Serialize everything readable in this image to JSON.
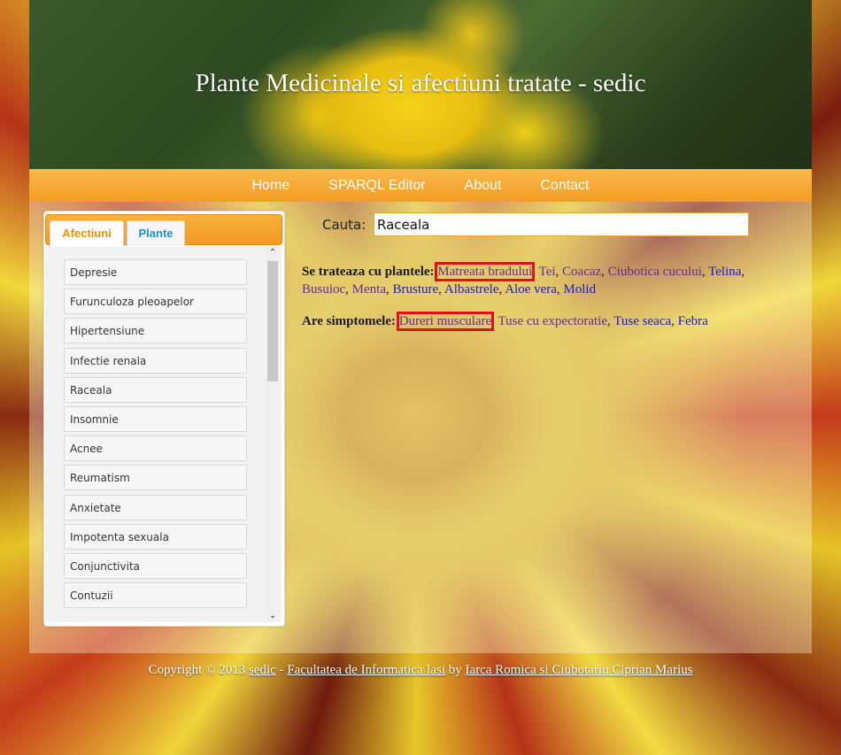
{
  "header": {
    "title": "Plante Medicinale si afectiuni tratate - sedic"
  },
  "nav": [
    "Home",
    "SPARQL Editor",
    "About",
    "Contact"
  ],
  "sidebar": {
    "tabs": [
      {
        "label": "Afectiuni",
        "active": true
      },
      {
        "label": "Plante",
        "active": false
      }
    ],
    "items": [
      "Depresie",
      "Furunculoza pleoapelor",
      "Hipertensiune",
      "Infectie renala",
      "Raceala",
      "Insomnie",
      "Acnee",
      "Reumatism",
      "Anxietate",
      "Impotenta sexuala",
      "Conjunctivita",
      "Contuzii"
    ]
  },
  "search": {
    "label": "Cauta:",
    "value": "Raceala"
  },
  "results": {
    "plants_label": "Se trateaza cu plantele:",
    "plants": [
      {
        "name": "Matreata bradului",
        "visited": true,
        "highlighted": true
      },
      {
        "name": "Tei",
        "visited": true
      },
      {
        "name": "Coacaz",
        "visited": true
      },
      {
        "name": "Ciubotica cucului",
        "visited": true
      },
      {
        "name": "Telina",
        "visited": false
      },
      {
        "name": "Busuioc",
        "visited": true
      },
      {
        "name": "Menta",
        "visited": true
      },
      {
        "name": "Brusture",
        "visited": false
      },
      {
        "name": "Albastrele",
        "visited": false
      },
      {
        "name": "Aloe vera",
        "visited": false
      },
      {
        "name": "Molid",
        "visited": false
      }
    ],
    "symptoms_label": "Are simptomele:",
    "symptoms": [
      {
        "name": "Dureri musculare",
        "visited": true,
        "highlighted": true
      },
      {
        "name": "Tuse cu expectoratie",
        "visited": true
      },
      {
        "name": "Tuse seaca",
        "visited": false
      },
      {
        "name": "Febra",
        "visited": false
      }
    ]
  },
  "footer": {
    "prefix": "Copyright © 2013",
    "site_link": "sedic",
    "sep": "-",
    "faculty_link": "Facultatea de Informatica Iasi",
    "by": "by",
    "authors_link": "Iarca Romica si Ciubotariu Ciprian Marius"
  },
  "colors": {
    "accent": "#f29d25",
    "highlight": "#e0101a",
    "link_visited": "#6b2b8a",
    "link": "#1a1acc"
  }
}
